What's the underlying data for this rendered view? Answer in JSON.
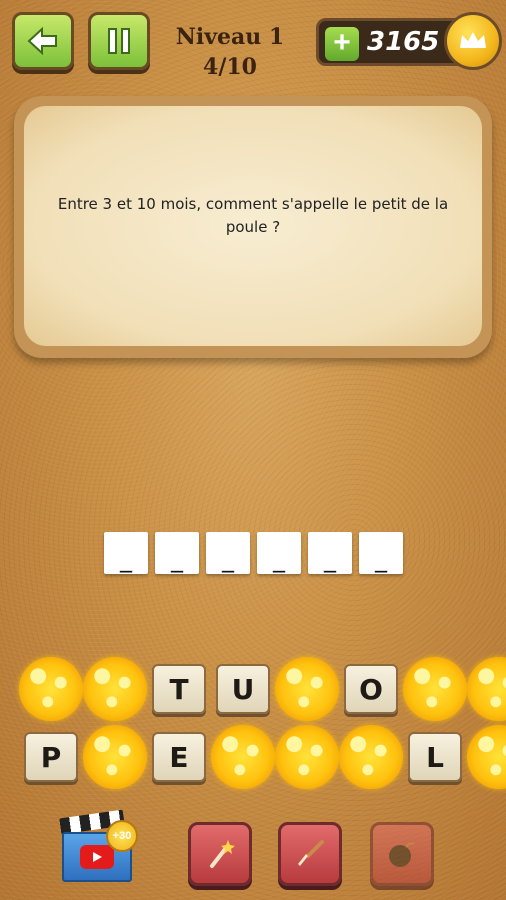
{
  "header": {
    "level_title": "Niveau 1",
    "progress": "4/10",
    "coins": "3165"
  },
  "question": {
    "text": "Entre 3 et 10 mois, comment s'appelle le petit de la poule ?"
  },
  "answer": {
    "slots": [
      "_",
      "_",
      "_",
      "_",
      "_",
      "_"
    ]
  },
  "letters": {
    "row1": [
      "",
      "",
      "T",
      "U",
      "",
      "O",
      "",
      ""
    ],
    "row2": [
      "P",
      "",
      "E",
      "",
      "",
      "",
      "L",
      ""
    ],
    "row1_burst": [
      true,
      true,
      false,
      false,
      true,
      false,
      true,
      true
    ],
    "row2_burst": [
      false,
      true,
      false,
      true,
      true,
      true,
      false,
      true
    ]
  },
  "powerups": {
    "video_bonus": "+30"
  },
  "colors": {
    "accent_green": "#7cc13a",
    "coin_gold": "#f3b61c",
    "powerup_red": "#b83b3e"
  }
}
